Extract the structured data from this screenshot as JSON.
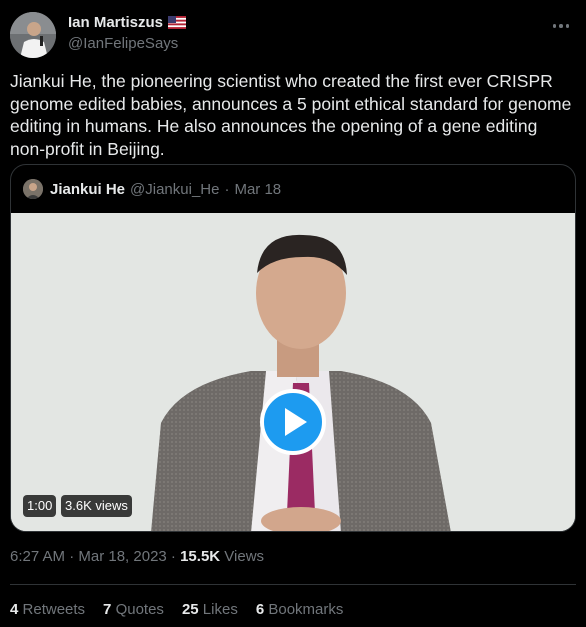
{
  "author": {
    "display_name": "Ian Martiszus",
    "handle": "@IanFelipeSays",
    "flag_icon": "us-flag-icon"
  },
  "tweet": {
    "text": "Jiankui He, the pioneering scientist who created the first ever CRISPR genome edited babies, announces a 5 point ethical standard for genome editing in humans. He also announces the opening of a gene editing non-profit in Beijing."
  },
  "quoted": {
    "display_name": "Jiankui He",
    "handle": "@Jiankui_He",
    "separator": "·",
    "date": "Mar 18",
    "video": {
      "duration": "1:00",
      "views": "3.6K views"
    }
  },
  "meta": {
    "timestamp": "6:27 AM · Mar 18, 2023 · ",
    "views_count": "15.5K",
    "views_label": " Views"
  },
  "stats": {
    "retweets_count": "4",
    "retweets_label": "Retweets",
    "quotes_count": "7",
    "quotes_label": "Quotes",
    "likes_count": "25",
    "likes_label": "Likes",
    "bookmarks_count": "6",
    "bookmarks_label": "Bookmarks"
  },
  "colors": {
    "background": "#000000",
    "text": "#e7e9ea",
    "secondary": "#71767b",
    "border": "#2f3336",
    "accent": "#1d9bf0"
  }
}
